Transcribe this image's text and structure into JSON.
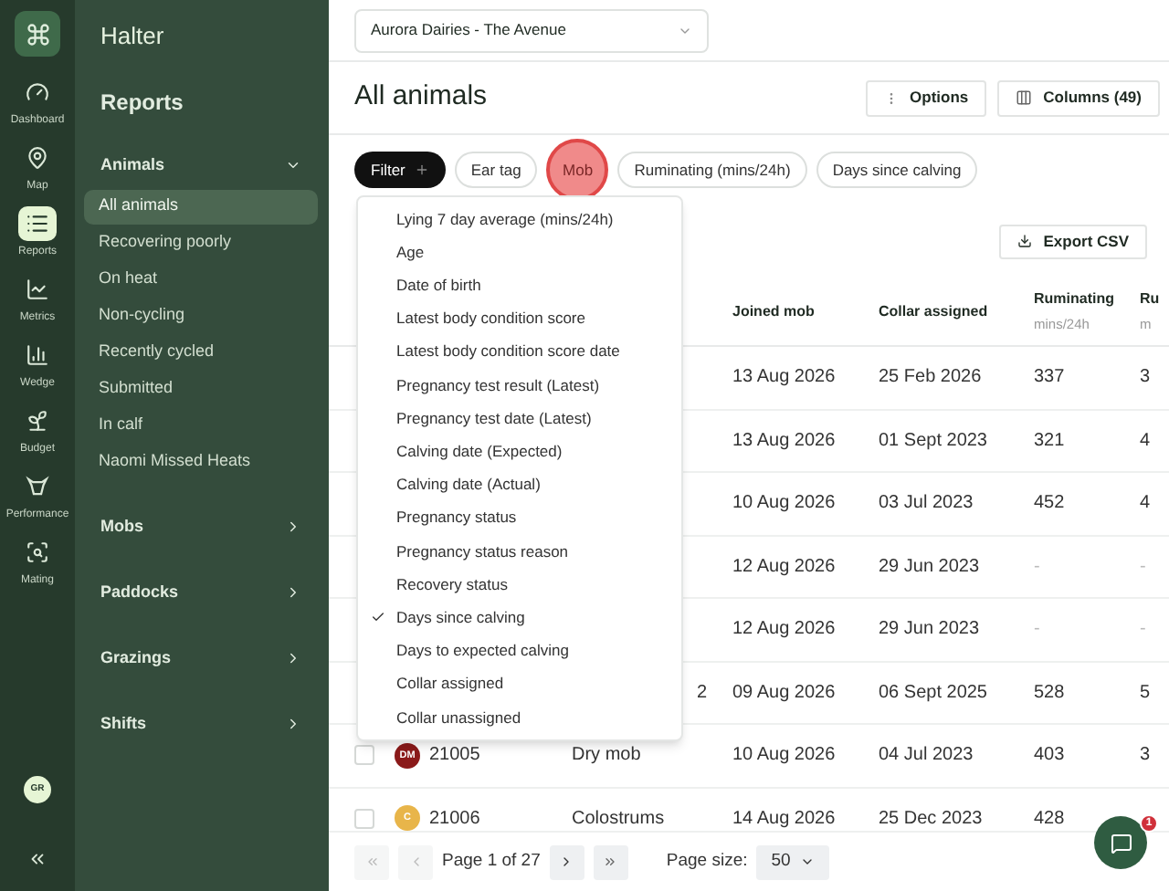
{
  "brand": {
    "name": "Halter"
  },
  "rail": [
    {
      "label": "Dashboard",
      "selected": false
    },
    {
      "label": "Map",
      "selected": false
    },
    {
      "label": "Reports",
      "selected": true
    },
    {
      "label": "Metrics",
      "selected": false
    },
    {
      "label": "Wedge",
      "selected": false
    },
    {
      "label": "Budget",
      "selected": false
    },
    {
      "label": "Performance",
      "selected": false
    },
    {
      "label": "Mating",
      "selected": false
    }
  ],
  "user": {
    "initials": "GR"
  },
  "sidebar": {
    "title": "Reports",
    "sections": [
      {
        "label": "Animals",
        "expanded": true,
        "items": [
          {
            "label": "All animals",
            "selected": true
          },
          {
            "label": "Recovering poorly",
            "selected": false
          },
          {
            "label": "On heat",
            "selected": false
          },
          {
            "label": "Non-cycling",
            "selected": false
          },
          {
            "label": "Recently cycled",
            "selected": false
          },
          {
            "label": "Submitted",
            "selected": false
          },
          {
            "label": "In calf",
            "selected": false
          },
          {
            "label": "Naomi Missed Heats",
            "selected": false
          }
        ]
      },
      {
        "label": "Mobs",
        "expanded": false
      },
      {
        "label": "Paddocks",
        "expanded": false
      },
      {
        "label": "Grazings",
        "expanded": false
      },
      {
        "label": "Shifts",
        "expanded": false
      }
    ]
  },
  "farm_select": {
    "value": "Aurora Dairies - The Avenue"
  },
  "page": {
    "title": "All animals",
    "buttons": [
      {
        "label": "Options"
      },
      {
        "label": "Columns (49)"
      }
    ]
  },
  "filters": [
    {
      "label": "Filter",
      "kind": "primary"
    },
    {
      "label": "Ear tag",
      "kind": "chip"
    },
    {
      "label": "Mob",
      "kind": "chip",
      "highlighted": true
    },
    {
      "label": "Ruminating (mins/24h)",
      "kind": "chip"
    },
    {
      "label": "Days since calving",
      "kind": "chip"
    }
  ],
  "dropdown": {
    "items": [
      {
        "label": "Lying 7 day average (mins/24h)",
        "checked": false
      },
      {
        "label": "Age",
        "checked": false
      },
      {
        "label": "Date of birth",
        "checked": false
      },
      {
        "label": "Latest body condition score",
        "checked": false
      },
      {
        "label": "Latest body condition score date",
        "checked": false
      },
      {
        "label": "Pregnancy test result (Latest)",
        "checked": false
      },
      {
        "label": "Pregnancy test date (Latest)",
        "checked": false
      },
      {
        "label": "Calving date (Expected)",
        "checked": false
      },
      {
        "label": "Calving date (Actual)",
        "checked": false
      },
      {
        "label": "Pregnancy status",
        "checked": false
      },
      {
        "label": "Pregnancy status reason",
        "checked": false
      },
      {
        "label": "Recovery status",
        "checked": false
      },
      {
        "label": "Days since calving",
        "checked": true
      },
      {
        "label": "Days to expected calving",
        "checked": false
      },
      {
        "label": "Collar assigned",
        "checked": false
      },
      {
        "label": "Collar unassigned",
        "checked": false
      }
    ]
  },
  "export_button": {
    "label": "Export CSV"
  },
  "table": {
    "columns": [
      {
        "label": "Joined mob"
      },
      {
        "label": "Collar assigned"
      },
      {
        "label": "Ruminating",
        "sub": "mins/24h"
      },
      {
        "label": "Ru",
        "sub": "m"
      }
    ],
    "rows": [
      {
        "joined": "13 Aug 2026",
        "collar": "25 Feb 2026",
        "ruminating": "337",
        "column_5": "3"
      },
      {
        "joined": "13 Aug 2026",
        "collar": "01 Sept 2023",
        "ruminating": "321",
        "column_5": "4"
      },
      {
        "joined": "10 Aug 2026",
        "collar": "03 Jul 2023",
        "ruminating": "452",
        "column_5": "4"
      },
      {
        "joined": "12 Aug 2026",
        "collar": "29 Jun 2023",
        "ruminating": "-",
        "column_5": "-"
      },
      {
        "joined": "12 Aug 2026",
        "collar": "29 Jun 2023",
        "ruminating": "-",
        "column_5": "-"
      },
      {
        "mob": "2",
        "joined": "09 Aug 2026",
        "collar": "06 Sept 2025",
        "ruminating": "528",
        "column_5": "5"
      },
      {
        "checked": false,
        "avatar": "DM",
        "color": "#8b1a1a",
        "ear_tag": "21005",
        "mob": "Dry mob",
        "joined": "10 Aug 2026",
        "collar": "04 Jul 2023",
        "ruminating": "403",
        "column_5": "3"
      },
      {
        "checked": false,
        "avatar": "C",
        "color": "#e8b54a",
        "ear_tag": "21006",
        "mob": "Colostrums",
        "joined": "14 Aug 2026",
        "collar": "25 Dec 2023",
        "ruminating": "428"
      }
    ]
  },
  "pagination": {
    "page_text": "Page 1 of 27",
    "page_size_label": "Page size:",
    "page_size": "50"
  },
  "chat": {
    "badge": "1"
  }
}
